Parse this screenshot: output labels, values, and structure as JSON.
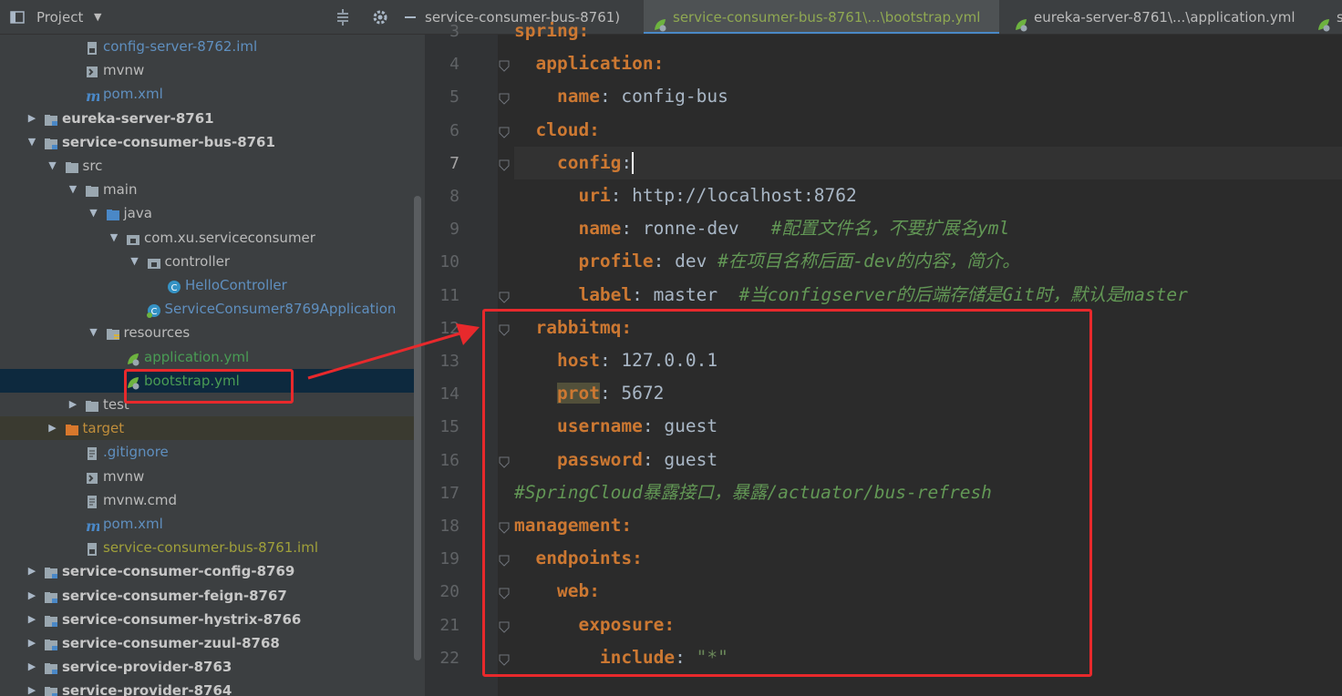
{
  "sidebar": {
    "title": "Project",
    "tree": [
      {
        "label": "config-server-8762.iml",
        "icon": "iml-file-icon",
        "depth": 3,
        "cls": "lb"
      },
      {
        "label": "mvnw",
        "icon": "script-file-icon",
        "depth": 3,
        "cls": ""
      },
      {
        "label": "pom.xml",
        "icon": "maven-icon",
        "depth": 3,
        "cls": "lb"
      },
      {
        "label": "eureka-server-8761",
        "icon": "module-folder-icon",
        "depth": 1,
        "cls": "bold",
        "arrow": "right"
      },
      {
        "label": "service-consumer-bus-8761",
        "icon": "module-folder-icon",
        "depth": 1,
        "cls": "bold",
        "arrow": "down"
      },
      {
        "label": "src",
        "icon": "folder-icon",
        "depth": 2,
        "arrow": "down"
      },
      {
        "label": "main",
        "icon": "folder-icon",
        "depth": 3,
        "arrow": "down"
      },
      {
        "label": "java",
        "icon": "source-folder-icon",
        "depth": 4,
        "arrow": "down"
      },
      {
        "label": "com.xu.serviceconsumer",
        "icon": "package-icon",
        "depth": 5,
        "arrow": "down"
      },
      {
        "label": "controller",
        "icon": "package-icon",
        "depth": 6,
        "arrow": "down"
      },
      {
        "label": "HelloController",
        "icon": "class-icon",
        "depth": 7,
        "cls": "lb"
      },
      {
        "label": "ServiceConsumer8769Application",
        "icon": "spring-boot-class-icon",
        "depth": 6,
        "cls": "lb"
      },
      {
        "label": "resources",
        "icon": "resources-folder-icon",
        "depth": 4,
        "arrow": "down"
      },
      {
        "label": "application.yml",
        "icon": "spring-yml-icon",
        "depth": 5,
        "cls": "grn"
      },
      {
        "label": "bootstrap.yml",
        "icon": "spring-yml-icon",
        "depth": 5,
        "cls": "grn",
        "selected": true
      },
      {
        "label": "test",
        "icon": "folder-icon",
        "depth": 3,
        "arrow": "right"
      },
      {
        "label": "target",
        "icon": "excluded-folder-icon",
        "depth": 2,
        "cls": "org",
        "arrow": "right",
        "highlight": true
      },
      {
        "label": ".gitignore",
        "icon": "text-file-icon",
        "depth": 3,
        "cls": "lb"
      },
      {
        "label": "mvnw",
        "icon": "script-file-icon",
        "depth": 3
      },
      {
        "label": "mvnw.cmd",
        "icon": "text-file-icon",
        "depth": 3
      },
      {
        "label": "pom.xml",
        "icon": "maven-icon",
        "depth": 3,
        "cls": "lb"
      },
      {
        "label": "service-consumer-bus-8761.iml",
        "icon": "iml-file-icon",
        "depth": 3,
        "cls": "yel"
      },
      {
        "label": "service-consumer-config-8769",
        "icon": "module-folder-icon",
        "depth": 1,
        "cls": "bold",
        "arrow": "right"
      },
      {
        "label": "service-consumer-feign-8767",
        "icon": "module-folder-icon",
        "depth": 1,
        "cls": "bold",
        "arrow": "right"
      },
      {
        "label": "service-consumer-hystrix-8766",
        "icon": "module-folder-icon",
        "depth": 1,
        "cls": "bold",
        "arrow": "right"
      },
      {
        "label": "service-consumer-zuul-8768",
        "icon": "module-folder-icon",
        "depth": 1,
        "cls": "bold",
        "arrow": "right"
      },
      {
        "label": "service-provider-8763",
        "icon": "module-folder-icon",
        "depth": 1,
        "cls": "bold",
        "arrow": "right"
      },
      {
        "label": "service-provider-8764",
        "icon": "module-folder-icon",
        "depth": 1,
        "cls": "bold",
        "arrow": "right"
      }
    ]
  },
  "tabs": [
    {
      "label": "service-consumer-bus-8761)",
      "active": false
    },
    {
      "label": "service-consumer-bus-8761\\...\\bootstrap.yml",
      "active": true
    },
    {
      "label": "eureka-server-8761\\...\\application.yml",
      "active": false
    },
    {
      "label": "s",
      "active": false
    }
  ],
  "editor": {
    "current_line": 7,
    "lines": [
      {
        "n": "3",
        "parts": [
          [
            "k",
            "spring:"
          ]
        ],
        "indent": 0
      },
      {
        "n": "4",
        "parts": [
          [
            "k",
            "application:"
          ]
        ],
        "indent": 1
      },
      {
        "n": "5",
        "parts": [
          [
            "k",
            "name"
          ],
          [
            "v",
            ": config-bus"
          ]
        ],
        "indent": 2
      },
      {
        "n": "6",
        "parts": [
          [
            "k",
            "cloud:"
          ]
        ],
        "indent": 1
      },
      {
        "n": "7",
        "parts": [
          [
            "k",
            "config"
          ],
          [
            "v",
            ":"
          ],
          [
            "caret",
            ""
          ]
        ],
        "indent": 2
      },
      {
        "n": "8",
        "parts": [
          [
            "k",
            "uri"
          ],
          [
            "v",
            ": http://localhost:8762"
          ]
        ],
        "indent": 3
      },
      {
        "n": "9",
        "parts": [
          [
            "k",
            "name"
          ],
          [
            "v",
            ": ronne-dev   "
          ],
          [
            "c",
            "#配置文件名，不要扩展名yml"
          ]
        ],
        "indent": 3
      },
      {
        "n": "10",
        "parts": [
          [
            "k",
            "profile"
          ],
          [
            "v",
            ": dev "
          ],
          [
            "c",
            "#在项目名称后面-dev的内容，简介。"
          ]
        ],
        "indent": 3
      },
      {
        "n": "11",
        "parts": [
          [
            "k",
            "label"
          ],
          [
            "v",
            ": master  "
          ],
          [
            "c",
            "#当configserver的后端存储是Git时，默认是master"
          ]
        ],
        "indent": 3
      },
      {
        "n": "12",
        "parts": [
          [
            "k",
            "rabbitmq:"
          ]
        ],
        "indent": 1
      },
      {
        "n": "13",
        "parts": [
          [
            "k",
            "host"
          ],
          [
            "v",
            ": 127.0.0.1"
          ]
        ],
        "indent": 2
      },
      {
        "n": "14",
        "parts": [
          [
            "khl",
            "prot"
          ],
          [
            "v",
            ": 5672"
          ]
        ],
        "indent": 2
      },
      {
        "n": "15",
        "parts": [
          [
            "k",
            "username"
          ],
          [
            "v",
            ": guest"
          ]
        ],
        "indent": 2
      },
      {
        "n": "16",
        "parts": [
          [
            "k",
            "password"
          ],
          [
            "v",
            ": guest"
          ]
        ],
        "indent": 2
      },
      {
        "n": "17",
        "parts": [
          [
            "c",
            "#SpringCloud暴露接口，暴露/actuator/bus-refresh"
          ]
        ],
        "indent": 0
      },
      {
        "n": "18",
        "parts": [
          [
            "k",
            "management:"
          ]
        ],
        "indent": 0
      },
      {
        "n": "19",
        "parts": [
          [
            "k",
            "endpoints:"
          ]
        ],
        "indent": 1
      },
      {
        "n": "20",
        "parts": [
          [
            "k",
            "web:"
          ]
        ],
        "indent": 2
      },
      {
        "n": "21",
        "parts": [
          [
            "k",
            "exposure:"
          ]
        ],
        "indent": 3
      },
      {
        "n": "22",
        "parts": [
          [
            "k",
            "include"
          ],
          [
            "v",
            ": "
          ],
          [
            "s",
            "\"*\""
          ]
        ],
        "indent": 4
      }
    ]
  },
  "colors": {
    "annotation": "#e8292c",
    "keyword": "#cc7832",
    "comment": "#629755",
    "string": "#6a8759"
  }
}
